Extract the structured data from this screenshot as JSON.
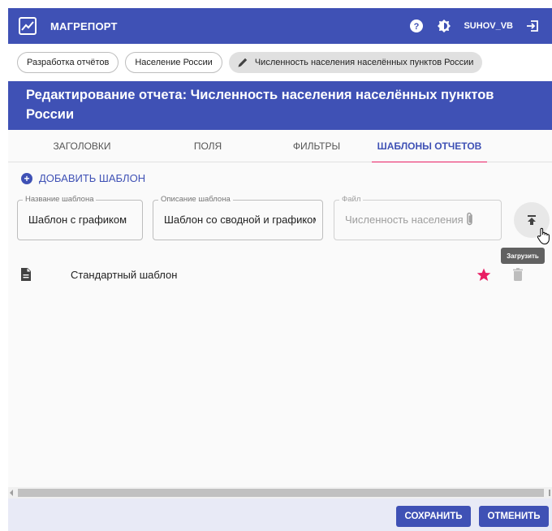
{
  "app": {
    "title": "МАГРЕПОРТ",
    "username": "SUHOV_VB",
    "colors": {
      "primary": "#3f51b5",
      "accent": "#e91e63",
      "footer_bg": "#e8eaf6"
    }
  },
  "breadcrumbs": [
    {
      "label": "Разработка отчётов"
    },
    {
      "label": "Население России"
    },
    {
      "label": "Численность населения населённых пунктов России",
      "icon": "pencil-icon"
    }
  ],
  "header": {
    "title": "Редактирование отчета: Численность населения населённых пунктов России"
  },
  "tabs": [
    {
      "label": "Заголовки",
      "active": false
    },
    {
      "label": "Поля",
      "active": false
    },
    {
      "label": "Фильтры",
      "active": false
    },
    {
      "label": "Шаблоны отчетов",
      "active": true
    }
  ],
  "templates_panel": {
    "add_label": "ДОБАВИТЬ ШАБЛОН",
    "fields": {
      "name": {
        "label": "Название шаблона",
        "value": "Шаблон с графиком"
      },
      "description": {
        "label": "Описание шаблона",
        "value": "Шаблон со сводной и графиком"
      },
      "file": {
        "label": "Файл",
        "placeholder": "Численность населения"
      }
    },
    "upload_tooltip": "Загрузить",
    "items": [
      {
        "label": "Стандартный шаблон",
        "favorite": true
      }
    ]
  },
  "footer": {
    "save_label": "СОХРАНИТЬ",
    "cancel_label": "ОТМЕНИТЬ"
  }
}
